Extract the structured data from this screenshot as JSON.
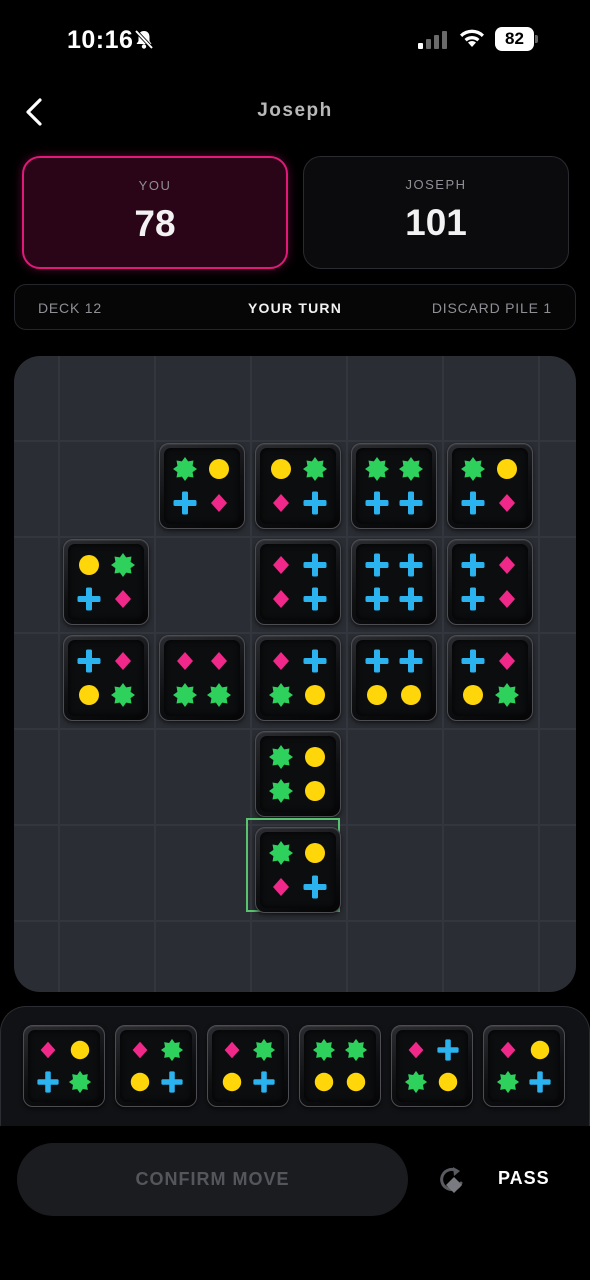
{
  "status_bar": {
    "time": "10:16",
    "battery": "82"
  },
  "header": {
    "title": "Joseph"
  },
  "scores": {
    "you": {
      "label": "YOU",
      "value": "78"
    },
    "opponent": {
      "label": "JOSEPH",
      "value": "101"
    }
  },
  "info_bar": {
    "deck": "DECK 12",
    "turn": "YOUR TURN",
    "discard": "DISCARD PILE 1"
  },
  "colors": {
    "green": "#2ed15c",
    "yellow": "#ffd60a",
    "blue": "#2bb3f0",
    "pink": "#f0288a",
    "accent": "#e0197a",
    "selection": "#58c26f"
  },
  "board": {
    "columns": 6,
    "rows": 6,
    "tiles": [
      {
        "row": 1,
        "col": 1,
        "symbols": [
          "green-star",
          "yellow-circle",
          "blue-cross",
          "pink-diamond"
        ]
      },
      {
        "row": 1,
        "col": 2,
        "symbols": [
          "yellow-circle",
          "green-star",
          "pink-diamond",
          "blue-cross"
        ]
      },
      {
        "row": 1,
        "col": 3,
        "symbols": [
          "green-star",
          "green-star",
          "blue-cross",
          "blue-cross"
        ]
      },
      {
        "row": 1,
        "col": 4,
        "symbols": [
          "green-star",
          "yellow-circle",
          "blue-cross",
          "pink-diamond"
        ]
      },
      {
        "row": 2,
        "col": 0,
        "symbols": [
          "yellow-circle",
          "green-star",
          "blue-cross",
          "pink-diamond"
        ]
      },
      {
        "row": 2,
        "col": 2,
        "symbols": [
          "pink-diamond",
          "blue-cross",
          "pink-diamond",
          "blue-cross"
        ]
      },
      {
        "row": 2,
        "col": 3,
        "symbols": [
          "blue-cross",
          "blue-cross",
          "blue-cross",
          "blue-cross"
        ]
      },
      {
        "row": 2,
        "col": 4,
        "symbols": [
          "blue-cross",
          "pink-diamond",
          "blue-cross",
          "pink-diamond"
        ]
      },
      {
        "row": 3,
        "col": 0,
        "symbols": [
          "blue-cross",
          "pink-diamond",
          "yellow-circle",
          "green-star"
        ]
      },
      {
        "row": 3,
        "col": 1,
        "symbols": [
          "pink-diamond",
          "pink-diamond",
          "green-star",
          "green-star"
        ]
      },
      {
        "row": 3,
        "col": 2,
        "symbols": [
          "pink-diamond",
          "blue-cross",
          "green-star",
          "yellow-circle"
        ]
      },
      {
        "row": 3,
        "col": 3,
        "symbols": [
          "blue-cross",
          "blue-cross",
          "yellow-circle",
          "yellow-circle"
        ]
      },
      {
        "row": 3,
        "col": 4,
        "symbols": [
          "blue-cross",
          "pink-diamond",
          "yellow-circle",
          "green-star"
        ]
      },
      {
        "row": 4,
        "col": 2,
        "symbols": [
          "green-star",
          "yellow-circle",
          "green-star",
          "yellow-circle"
        ]
      },
      {
        "row": 5,
        "col": 2,
        "symbols": [
          "green-star",
          "yellow-circle",
          "pink-diamond",
          "blue-cross"
        ],
        "selected": true
      }
    ]
  },
  "hand": {
    "tiles": [
      {
        "symbols": [
          "pink-diamond",
          "yellow-circle",
          "blue-cross",
          "green-star"
        ]
      },
      {
        "symbols": [
          "pink-diamond",
          "green-star",
          "yellow-circle",
          "blue-cross"
        ]
      },
      {
        "symbols": [
          "pink-diamond",
          "green-star",
          "yellow-circle",
          "blue-cross"
        ]
      },
      {
        "symbols": [
          "green-star",
          "green-star",
          "yellow-circle",
          "yellow-circle"
        ]
      },
      {
        "symbols": [
          "pink-diamond",
          "blue-cross",
          "green-star",
          "yellow-circle"
        ]
      },
      {
        "symbols": [
          "pink-diamond",
          "yellow-circle",
          "green-star",
          "blue-cross"
        ]
      }
    ]
  },
  "actions": {
    "confirm": "CONFIRM MOVE",
    "pass": "PASS"
  }
}
